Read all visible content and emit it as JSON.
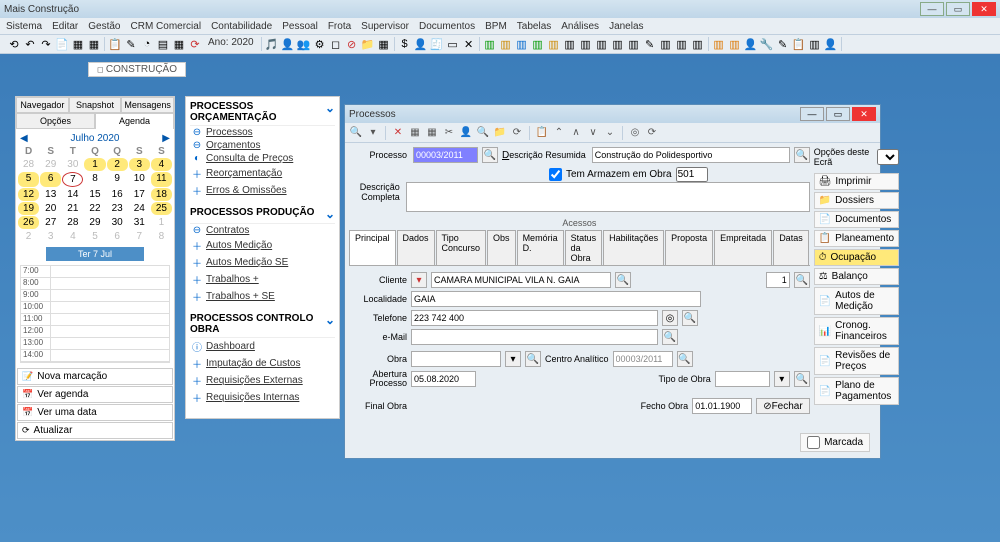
{
  "app": {
    "title": "Mais Construção"
  },
  "menu": [
    "Sistema",
    "Editar",
    "Gestão",
    "CRM Comercial",
    "Contabilidade",
    "Pessoal",
    "Frota",
    "Supervisor",
    "Documentos",
    "BPM",
    "Tabelas",
    "Análises",
    "Janelas"
  ],
  "toolbar_year": "Ano: 2020",
  "crumb": "CONSTRUÇÃO",
  "nav_tabs_top": [
    "Navegador",
    "Snapshot",
    "Mensagens"
  ],
  "nav_tabs_sub": [
    "Opções",
    "Agenda"
  ],
  "calendar": {
    "month": "Julho 2020",
    "dow": [
      "D",
      "S",
      "T",
      "Q",
      "Q",
      "S",
      "S"
    ],
    "day_label": "Ter 7 Jul"
  },
  "times": [
    "7:00",
    "8:00",
    "9:00",
    "10:00",
    "11:00",
    "12:00",
    "13:00",
    "14:00"
  ],
  "left_btns": {
    "nova": "Nova marcação",
    "ver": "Ver agenda",
    "data": "Ver uma data",
    "atual": "Atualizar"
  },
  "sections": {
    "orc": {
      "title": "PROCESSOS ORÇAMENTAÇÃO",
      "items": [
        {
          "ic": "⊖",
          "t": "Processos"
        },
        {
          "ic": "⊖",
          "t": "Orçamentos"
        },
        {
          "ic": "◐",
          "t": "Consulta de Preços"
        },
        {
          "ic": "＋",
          "t": "Reorçamentação"
        },
        {
          "ic": "＋",
          "t": "Erros & Omissões"
        }
      ]
    },
    "prod": {
      "title": "PROCESSOS PRODUÇÃO",
      "items": [
        {
          "ic": "⊖",
          "t": "Contratos"
        },
        {
          "ic": "＋",
          "t": "Autos Medição"
        },
        {
          "ic": "＋",
          "t": "Autos Medição SE"
        },
        {
          "ic": "＋",
          "t": "Trabalhos +"
        },
        {
          "ic": "＋",
          "t": "Trabalhos + SE"
        }
      ]
    },
    "ctrl": {
      "title": "PROCESSOS CONTROLO OBRA",
      "items": [
        {
          "ic": "ⓘ",
          "t": "Dashboard"
        },
        {
          "ic": "＋",
          "t": "Imputação de Custos"
        },
        {
          "ic": "＋",
          "t": "Requisições Externas"
        },
        {
          "ic": "＋",
          "t": "Requisições Internas"
        }
      ]
    }
  },
  "win": {
    "title": "Processos",
    "proc_lbl": "Processo",
    "proc_val": "00003/2011",
    "desc_res_lbl": "Descrição Resumida",
    "desc_res_val": "Construção do Polidesportivo",
    "arm_lbl": "Tem Armazem em Obra",
    "arm_val": "501",
    "desc_comp_lbl": "Descrição Completa",
    "acessos": "Acessos",
    "dtabs": [
      "Principal",
      "Dados",
      "Tipo Concurso",
      "Obs",
      "Memória D.",
      "Status da Obra",
      "Habilitações",
      "Proposta",
      "Empreitada",
      "Datas"
    ],
    "cliente_lbl": "Cliente",
    "cliente_val": "CAMARA MUNICIPAL VILA N. GAIA",
    "cliente_n": "1",
    "local_lbl": "Localidade",
    "local_val": "GAIA",
    "tel_lbl": "Telefone",
    "tel_val": "223 742 400",
    "email_lbl": "e-Mail",
    "obra_lbl": "Obra",
    "centro_lbl": "Centro Analítico",
    "centro_val": "00003/2011",
    "abert_lbl": "Abertura Processo",
    "abert_val": "05.08.2020",
    "tipo_lbl": "Tipo de Obra",
    "final_lbl": "Final Obra",
    "fecho_lbl": "Fecho Obra",
    "fecho_val": "01.01.1900",
    "fechar": "Fechar",
    "side_hdr": "Opções deste Ecrã",
    "side": [
      {
        "i": "🖨",
        "t": "Imprimir"
      },
      {
        "i": "📁",
        "t": "Dossiers"
      },
      {
        "i": "📄",
        "t": "Documentos"
      },
      {
        "i": "📋",
        "t": "Planeamento"
      },
      {
        "i": "⏱",
        "t": "Ocupação",
        "hl": 1
      },
      {
        "i": "⚖",
        "t": "Balanço"
      },
      {
        "i": "📄",
        "t": "Autos de Medição"
      },
      {
        "i": "📊",
        "t": "Cronog. Financeiros"
      },
      {
        "i": "📄",
        "t": "Revisões de Preços"
      },
      {
        "i": "📄",
        "t": "Plano de Pagamentos"
      }
    ],
    "marcada": "Marcada"
  }
}
